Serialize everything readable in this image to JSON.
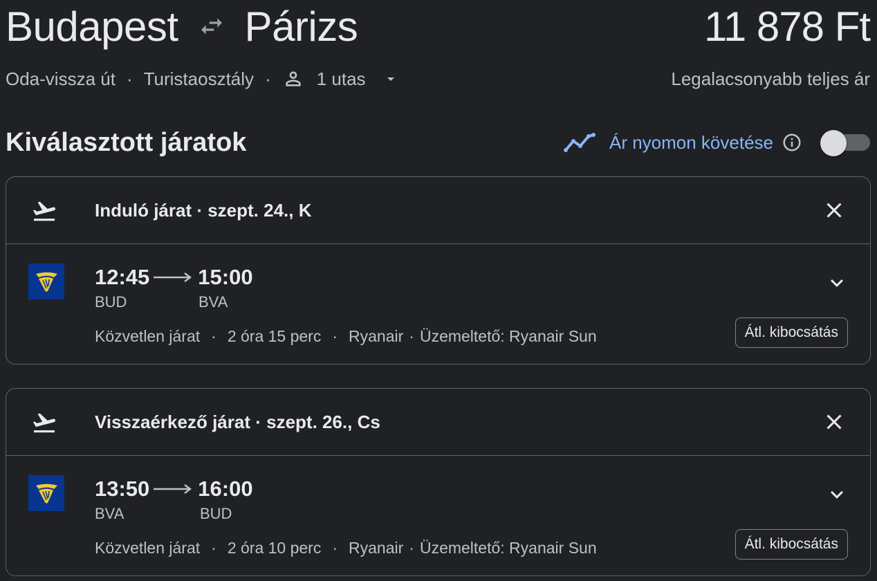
{
  "header": {
    "origin": "Budapest",
    "destination": "Párizs",
    "price": "11 878 Ft",
    "trip_type": "Oda-vissza út",
    "cabin_class": "Turistaosztály",
    "passengers": "1 utas",
    "price_note": "Legalacsonyabb teljes ár",
    "separator": "·"
  },
  "section": {
    "title": "Kiválasztott járatok",
    "track_label": "Ár nyomon követése",
    "track_enabled": false
  },
  "flights": [
    {
      "header": "Induló járat · szept. 24., K",
      "departure_time": "12:45",
      "arrival_time": "15:00",
      "departure_airport": "BUD",
      "arrival_airport": "BVA",
      "stops": "Közvetlen járat",
      "duration": "2 óra 15 perc",
      "airline": "Ryanair",
      "operator": "Üzemeltető: Ryanair Sun",
      "emission_label": "Átl. kibocsátás"
    },
    {
      "header": "Visszaérkező járat · szept. 26., Cs",
      "departure_time": "13:50",
      "arrival_time": "16:00",
      "departure_airport": "BVA",
      "arrival_airport": "BUD",
      "stops": "Közvetlen járat",
      "duration": "2 óra 10 perc",
      "airline": "Ryanair",
      "operator": "Üzemeltető: Ryanair Sun",
      "emission_label": "Átl. kibocsátás"
    }
  ],
  "icons": {
    "swap": "swap-arrows-icon",
    "person": "person-icon",
    "caret": "caret-down-icon",
    "trend": "trending-line-icon",
    "info": "info-icon",
    "departure": "flight-takeoff-icon",
    "return": "flight-land-icon",
    "close": "close-icon",
    "expand": "chevron-down-icon",
    "airline_logo": "ryanair-logo"
  },
  "colors": {
    "background": "#202124",
    "text": "#e8eaed",
    "secondary_text": "#bdc1c6",
    "accent": "#8ab4f8",
    "border": "#5f6368",
    "ryanair_blue": "#073590",
    "ryanair_yellow": "#f1c933"
  }
}
